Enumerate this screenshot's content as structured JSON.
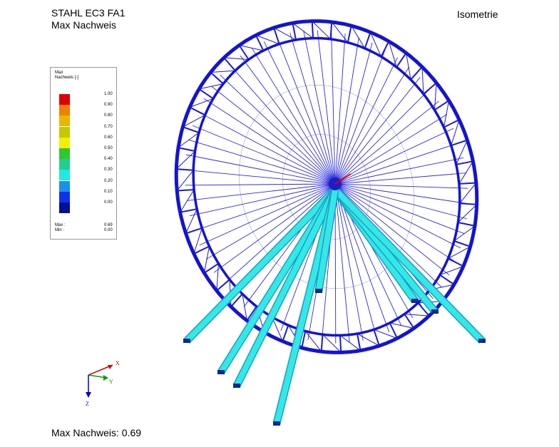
{
  "header": {
    "line1": "STAHL EC3 FA1",
    "line2": "Max Nachweis"
  },
  "view_label": "Isometrie",
  "legend": {
    "title1": "Max",
    "title2": "Nachweis [-]",
    "scale": [
      {
        "value": "1.00",
        "color": "#e00000"
      },
      {
        "value": "0.90",
        "color": "#f08000"
      },
      {
        "value": "0.80",
        "color": "#e8b800"
      },
      {
        "value": "0.70",
        "color": "#c8c800"
      },
      {
        "value": "0.60",
        "color": "#f0f000"
      },
      {
        "value": "0.50",
        "color": "#30c830"
      },
      {
        "value": "0.40",
        "color": "#20d090"
      },
      {
        "value": "0.30",
        "color": "#20e8e8"
      },
      {
        "value": "0.20",
        "color": "#1890f0"
      },
      {
        "value": "0.10",
        "color": "#1030f0"
      },
      {
        "value": "0.00",
        "color": "#001090"
      }
    ],
    "max_label": "Max :",
    "max_value": "0.69",
    "min_label": "Min :",
    "min_value": "0.00"
  },
  "axes": {
    "x": "X",
    "y": "Y",
    "z": "Z"
  },
  "footer": "Max Nachweis: 0.69"
}
